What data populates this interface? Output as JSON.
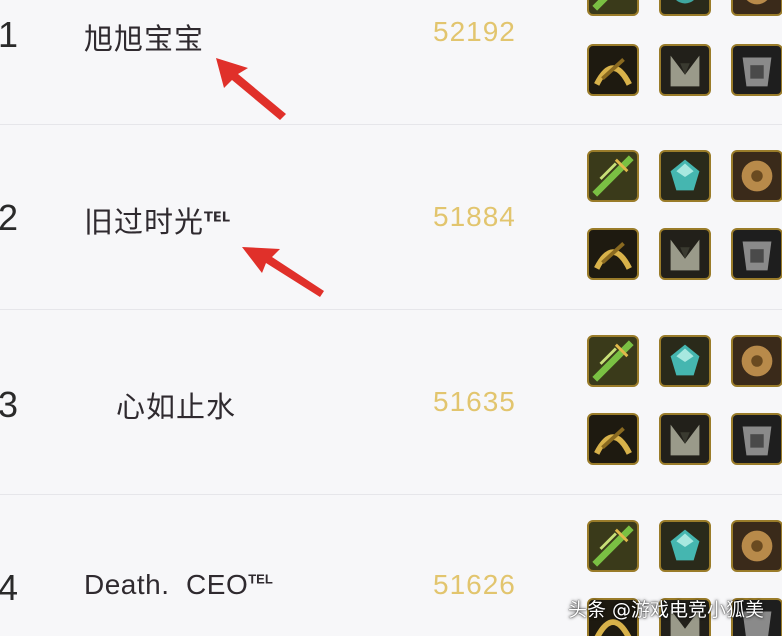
{
  "leaderboard": [
    {
      "rank": "1",
      "name": "旭旭宝宝",
      "tag": "",
      "score": "52192"
    },
    {
      "rank": "2",
      "name": "旧过时光",
      "tag": "TEL",
      "score": "51884"
    },
    {
      "rank": "3",
      "name": "心如止水",
      "tag": "",
      "score": "51635"
    },
    {
      "rank": "4",
      "name": "Death.  CEO",
      "tag": "TEL",
      "score": "51626"
    }
  ],
  "watermark": "头条 @游戏电竞小狐美",
  "colors": {
    "score": "#e2c56e",
    "arrow": "#e0302a",
    "row_bg": "#f7f7f9",
    "item_border": "#d4a93a"
  },
  "item_icons": [
    "green-weapon-icon",
    "teal-gem-icon",
    "bronze-orb-icon",
    "gold-armor-icon",
    "silver-armor-icon",
    "steel-armor-icon"
  ]
}
